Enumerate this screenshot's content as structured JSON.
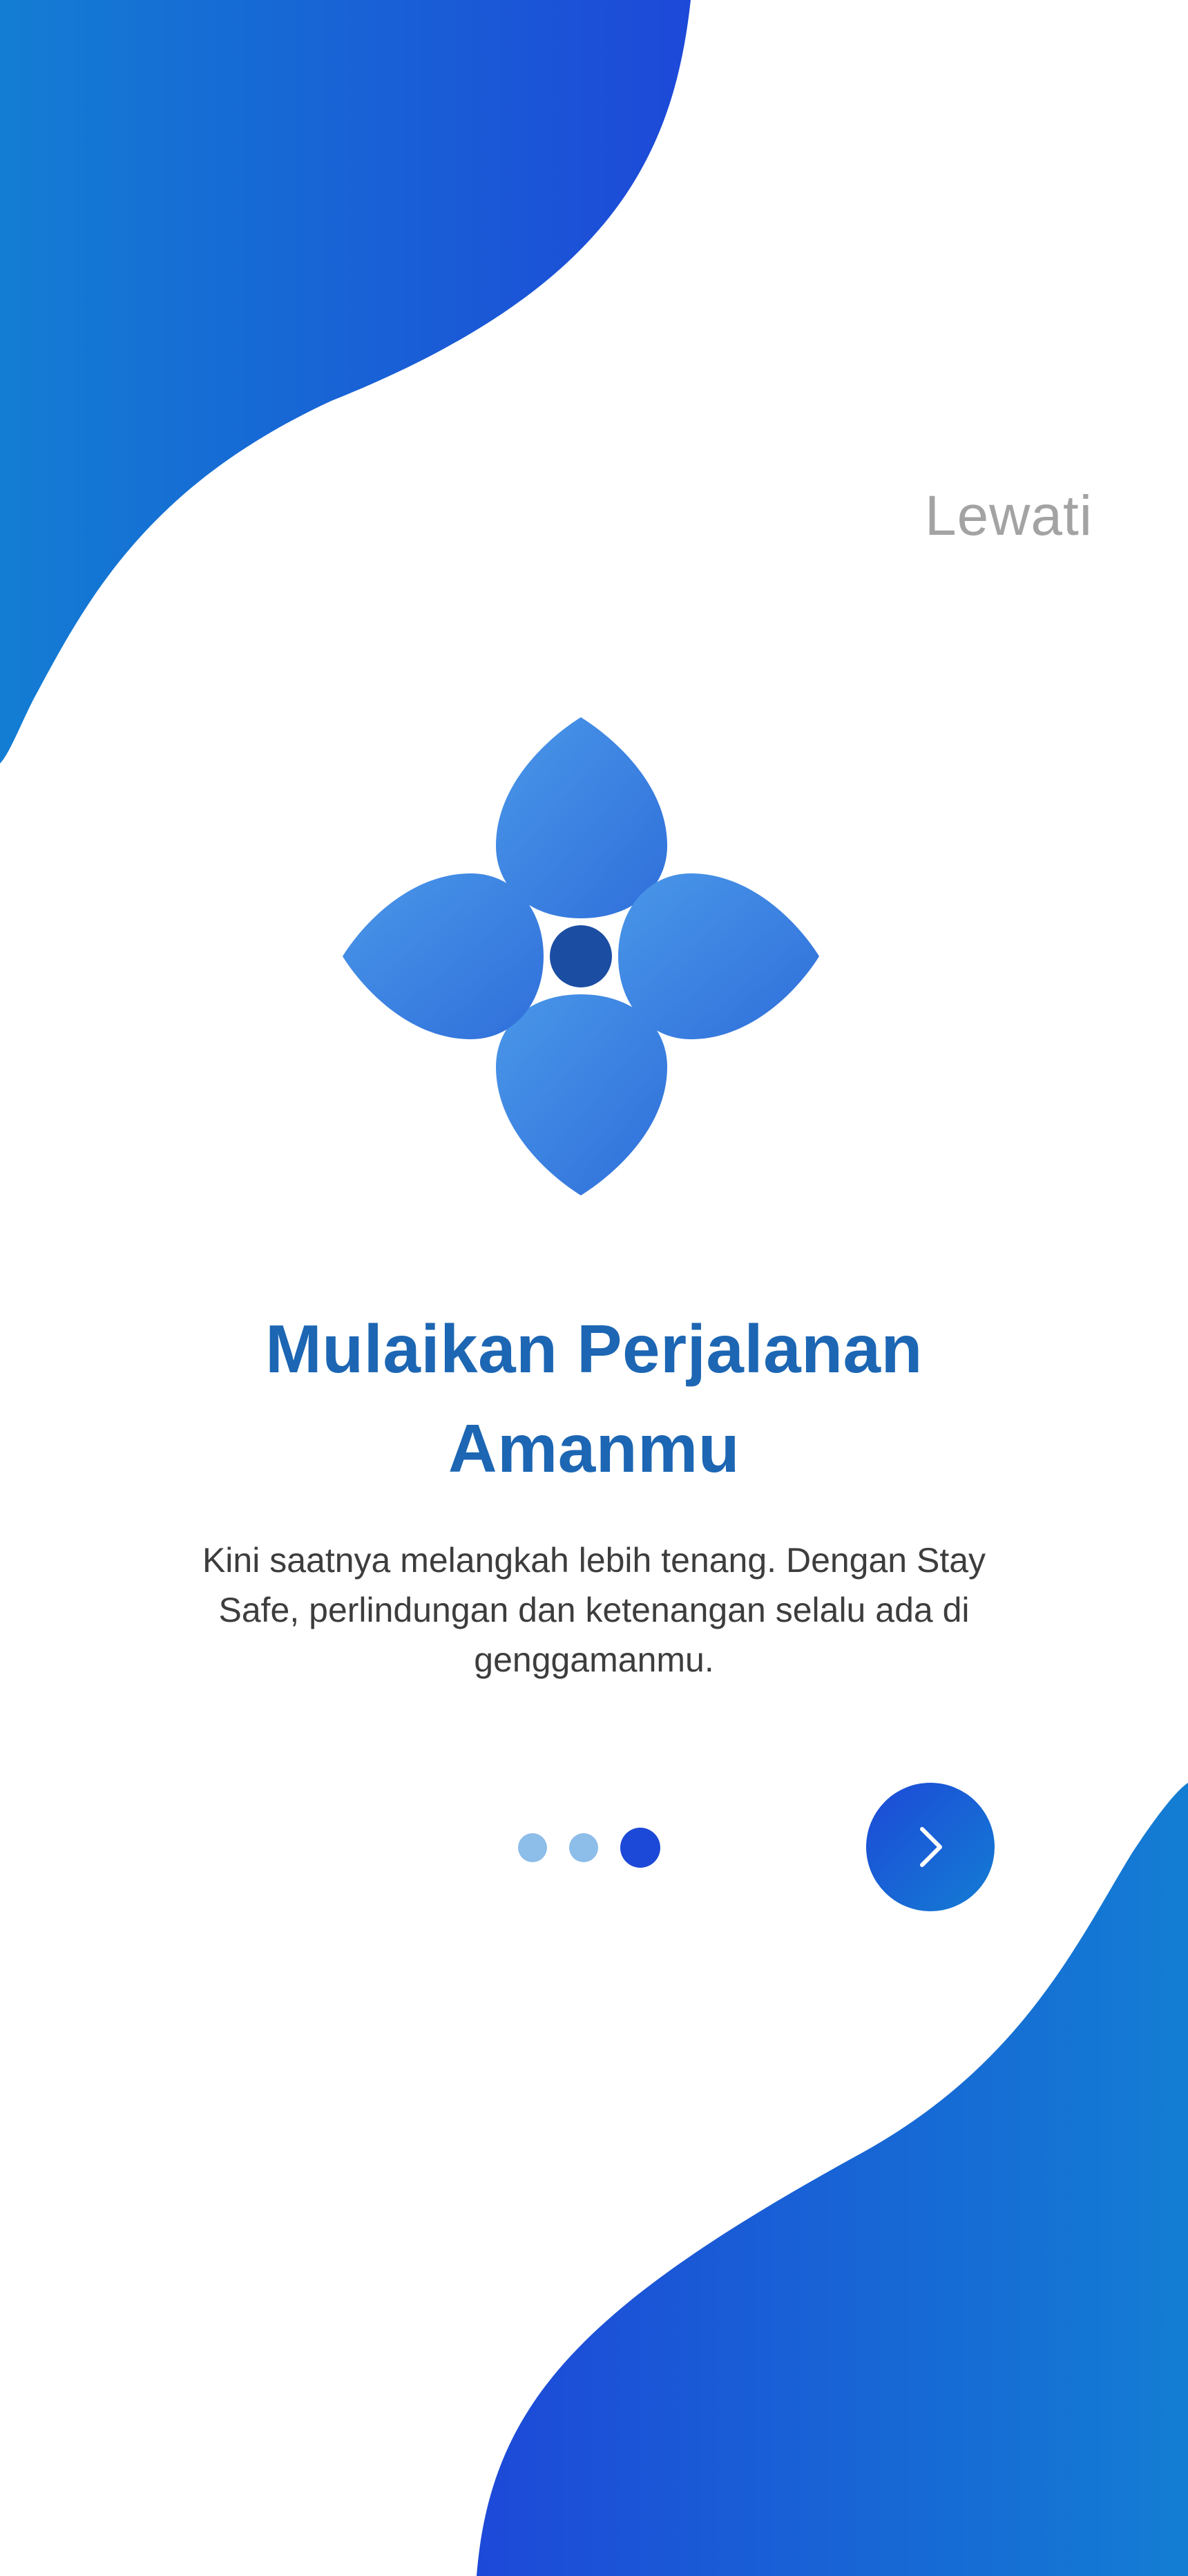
{
  "colors": {
    "brand_blue_dark": "#1d49d8",
    "brand_blue_light": "#137dd3",
    "title_blue": "#1c66b3",
    "petal_light": "#4a97e9",
    "petal_dark": "#2f6fda",
    "logo_center": "#1b4ea3",
    "dot_inactive": "#8dbde9",
    "dot_active": "#1d49d8",
    "skip_gray": "#a3a3a3",
    "body_text": "#3d3d3d"
  },
  "header": {
    "skip_label": "Lewati"
  },
  "onboarding": {
    "logo_icon": "flower-logo-icon",
    "title_line1": "Mulaikan Perjalanan",
    "title_line2": "Amanmu",
    "description": "Kini saatnya melangkah lebih tenang. Dengan Stay Safe, perlindungan dan ketenangan selalu ada di genggamanmu."
  },
  "pagination": {
    "total_pages": 3,
    "current_page": 3
  },
  "next_button": {
    "icon": "chevron-right-icon"
  }
}
